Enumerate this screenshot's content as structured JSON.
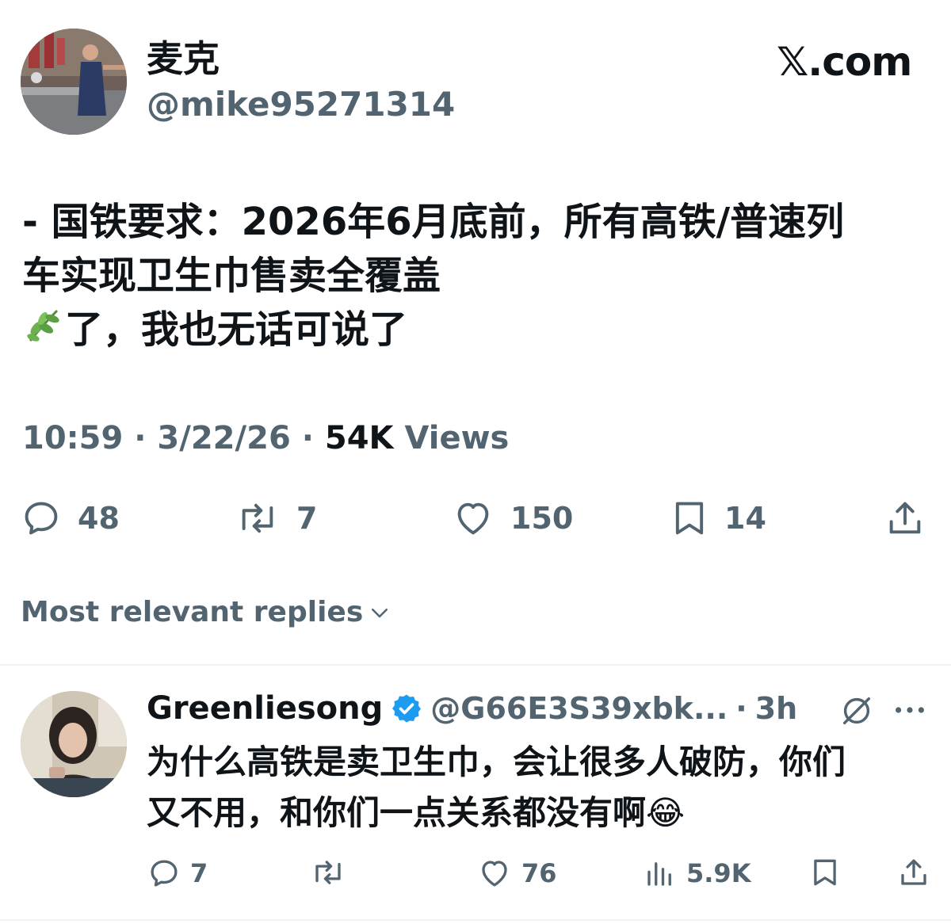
{
  "author": {
    "display_name": "麦克",
    "handle": "@mike95271314"
  },
  "brand": {
    "site": "𝕏.com"
  },
  "tweet": {
    "lines": [
      "- 国铁要求：2026年6月底前，所有高铁/普速列",
      "车实现卫生巾售卖全覆盖",
      "了，我也无话可说了"
    ],
    "leaf_emoji": "🌿"
  },
  "meta": {
    "time": "10:59",
    "sep1": "·",
    "date": "3/22/26",
    "sep2": "·",
    "views_count": "54K",
    "views_label": "Views"
  },
  "actions": {
    "replies": "48",
    "retweets": "7",
    "likes": "150",
    "bookmarks": "14"
  },
  "sort": {
    "label": "Most relevant replies"
  },
  "reply": {
    "name": "Greenliesong",
    "handle": "@G66E3S39xbk...",
    "sep": "·",
    "time": "3h",
    "text_lines": [
      "为什么高铁是卖卫生巾，会让很多人破防，你们",
      "又不用，和你们一点关系都没有啊"
    ],
    "emoji": "😂",
    "actions": {
      "replies": "7",
      "likes": "76",
      "views": "5.9K"
    }
  },
  "colors": {
    "text": "#0f1419",
    "secondary": "#536471",
    "verified": "#1d9bf0",
    "divider": "#eff3f4"
  }
}
